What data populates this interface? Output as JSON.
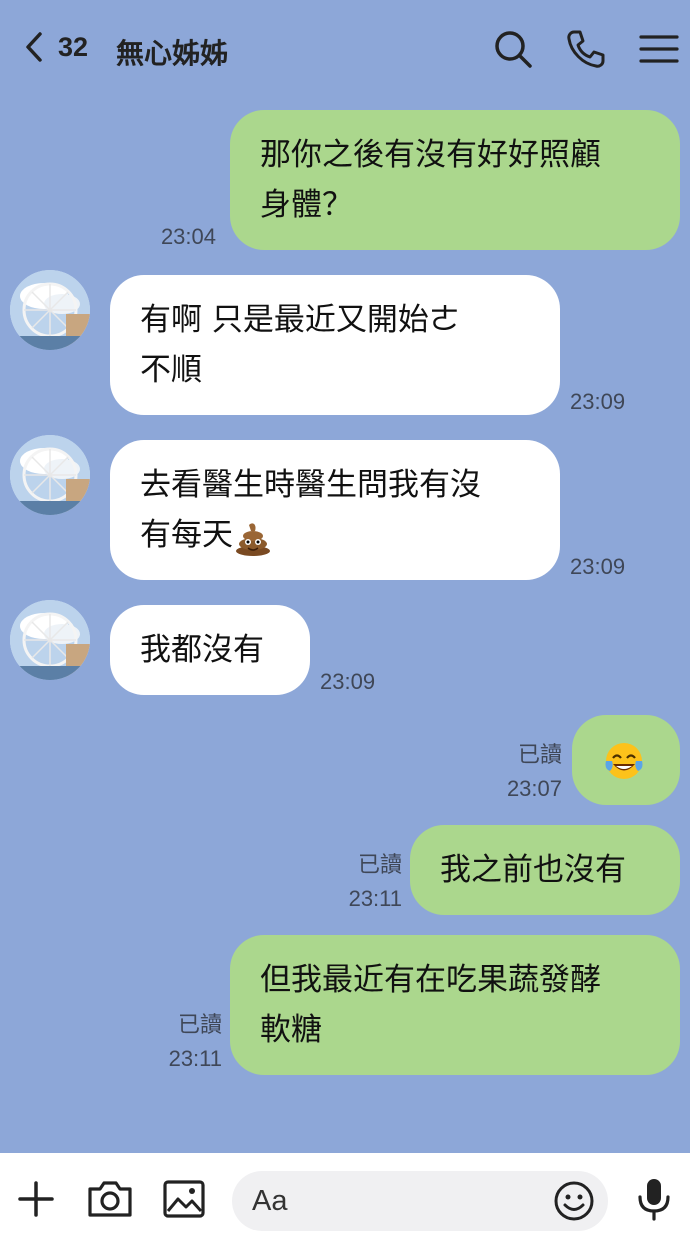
{
  "header": {
    "unread_count": "32",
    "title": "無心姊姊"
  },
  "messages": [
    {
      "side": "me",
      "lines": [
        "那你之後有沒有好好照顧",
        "身體？"
      ],
      "time": "23:04"
    },
    {
      "side": "them",
      "lines": [
        "有啊 只是最近又開始ㄜ",
        "不順"
      ],
      "time": "23:09"
    },
    {
      "side": "them",
      "lines": [
        "去看醫生時醫生問我有沒",
        "有每天"
      ],
      "emoji": "poop-emoji",
      "time": "23:09"
    },
    {
      "side": "them",
      "lines": [
        "我都沒有"
      ],
      "time": "23:09"
    },
    {
      "side": "me",
      "emoji": "tears-of-joy-emoji",
      "read": "已讀",
      "time": "23:07"
    },
    {
      "side": "me",
      "lines": [
        "我之前也沒有"
      ],
      "read": "已讀",
      "time": "23:11"
    },
    {
      "side": "me",
      "lines": [
        "但我最近有在吃果蔬發酵",
        "軟糖"
      ],
      "read": "已讀",
      "time": "23:11"
    }
  ],
  "input": {
    "placeholder": "Aa"
  },
  "colors": {
    "background": "#8da7d8",
    "my_bubble": "#abd78d",
    "their_bubble": "#ffffff"
  },
  "icons": [
    "chevron-left-icon",
    "search-icon",
    "phone-icon",
    "menu-icon",
    "plus-icon",
    "camera-icon",
    "image-icon",
    "emoji-icon",
    "microphone-icon"
  ]
}
